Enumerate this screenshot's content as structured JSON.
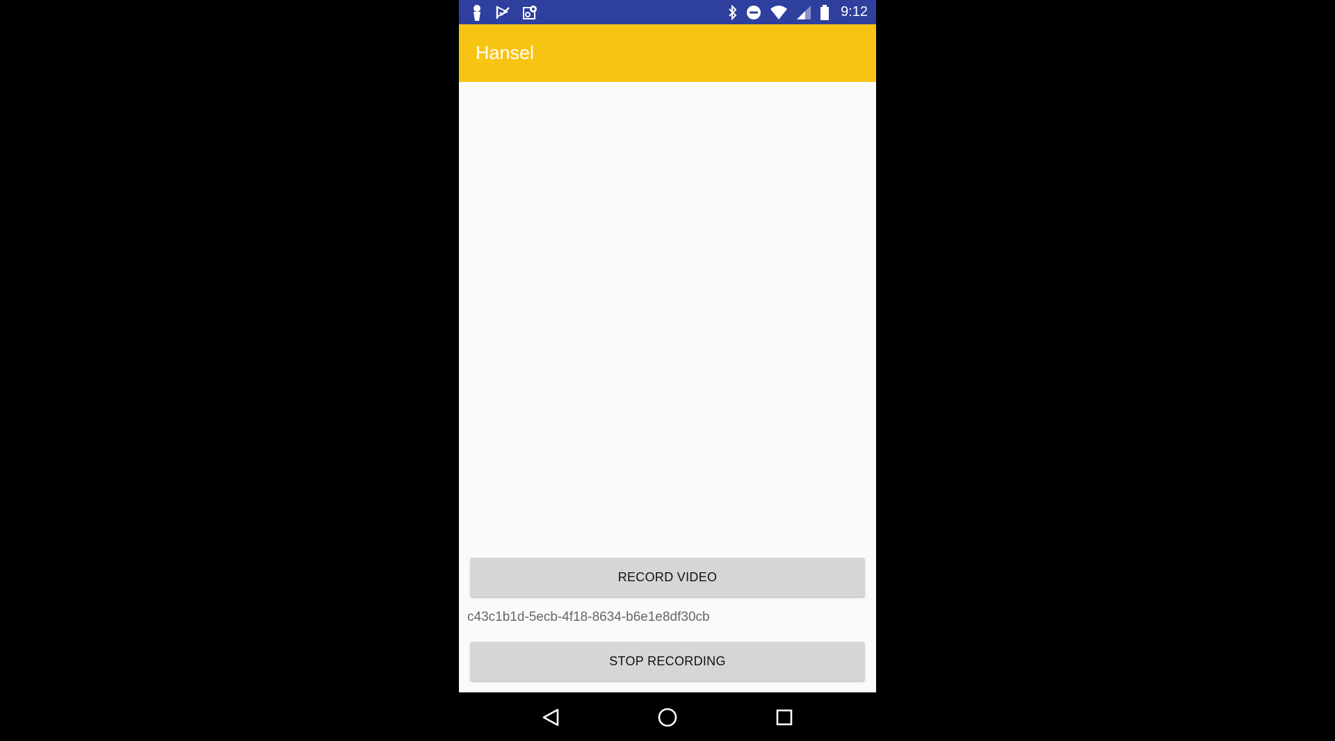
{
  "status_bar": {
    "time": "9:12",
    "left_icons": [
      "person-pin-icon",
      "check-flag-icon",
      "map-settings-icon"
    ],
    "right_icons": [
      "bluetooth-icon",
      "do-not-disturb-icon",
      "wifi-icon",
      "cell-signal-icon",
      "battery-icon"
    ],
    "background": "#2e3f9e"
  },
  "app_bar": {
    "title": "Hansel",
    "background": "#f8c414"
  },
  "main": {
    "record_button_label": "RECORD VIDEO",
    "session_id": "c43c1b1d-5ecb-4f18-8634-b6e1e8df30cb",
    "stop_button_label": "STOP RECORDING"
  },
  "nav_bar": {
    "icons": [
      "back-icon",
      "home-icon",
      "recent-apps-icon"
    ]
  }
}
